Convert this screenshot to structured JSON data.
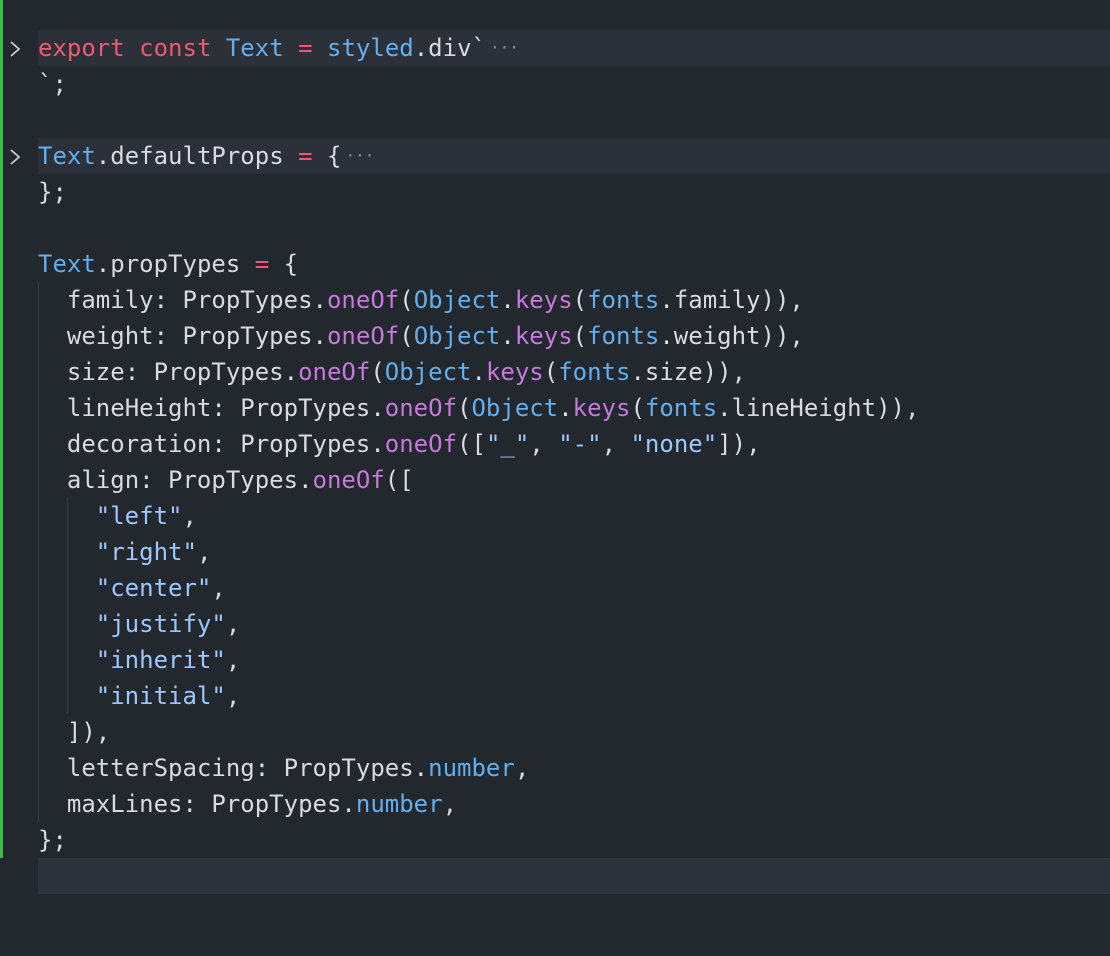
{
  "colors": {
    "background": "#23272e",
    "keyword": "#ef596f",
    "class": "#61afef",
    "function": "#c678dd",
    "string": "#9cc8ff",
    "text": "#d7dae0",
    "git_added": "#3fb950"
  },
  "lines": [
    {
      "folded": true,
      "tokens": [
        [
          "kw",
          "export"
        ],
        [
          "plain",
          " "
        ],
        [
          "kw",
          "const"
        ],
        [
          "plain",
          " "
        ],
        [
          "cls",
          "Text"
        ],
        [
          "plain",
          " "
        ],
        [
          "op",
          "="
        ],
        [
          "plain",
          " "
        ],
        [
          "cls",
          "styled"
        ],
        [
          "plain",
          ".div`"
        ]
      ]
    },
    {
      "folded": false,
      "tokens": [
        [
          "plain",
          "`;"
        ]
      ]
    },
    {
      "folded": false,
      "tokens": []
    },
    {
      "folded": true,
      "tokens": [
        [
          "cls",
          "Text"
        ],
        [
          "plain",
          ".defaultProps "
        ],
        [
          "op",
          "="
        ],
        [
          "plain",
          " {"
        ]
      ]
    },
    {
      "folded": false,
      "tokens": [
        [
          "plain",
          "};"
        ]
      ]
    },
    {
      "folded": false,
      "tokens": []
    },
    {
      "folded": false,
      "tokens": [
        [
          "cls",
          "Text"
        ],
        [
          "plain",
          ".propTypes "
        ],
        [
          "op",
          "="
        ],
        [
          "plain",
          " {"
        ]
      ]
    },
    {
      "folded": false,
      "indent": 1,
      "tokens": [
        [
          "plain",
          "family: PropTypes."
        ],
        [
          "fn",
          "oneOf"
        ],
        [
          "plain",
          "("
        ],
        [
          "cls",
          "Object"
        ],
        [
          "plain",
          "."
        ],
        [
          "fn",
          "keys"
        ],
        [
          "plain",
          "("
        ],
        [
          "cls",
          "fonts"
        ],
        [
          "plain",
          ".family)),"
        ]
      ]
    },
    {
      "folded": false,
      "indent": 1,
      "tokens": [
        [
          "plain",
          "weight: PropTypes."
        ],
        [
          "fn",
          "oneOf"
        ],
        [
          "plain",
          "("
        ],
        [
          "cls",
          "Object"
        ],
        [
          "plain",
          "."
        ],
        [
          "fn",
          "keys"
        ],
        [
          "plain",
          "("
        ],
        [
          "cls",
          "fonts"
        ],
        [
          "plain",
          ".weight)),"
        ]
      ]
    },
    {
      "folded": false,
      "indent": 1,
      "tokens": [
        [
          "plain",
          "size: PropTypes."
        ],
        [
          "fn",
          "oneOf"
        ],
        [
          "plain",
          "("
        ],
        [
          "cls",
          "Object"
        ],
        [
          "plain",
          "."
        ],
        [
          "fn",
          "keys"
        ],
        [
          "plain",
          "("
        ],
        [
          "cls",
          "fonts"
        ],
        [
          "plain",
          ".size)),"
        ]
      ]
    },
    {
      "folded": false,
      "indent": 1,
      "tokens": [
        [
          "plain",
          "lineHeight: PropTypes."
        ],
        [
          "fn",
          "oneOf"
        ],
        [
          "plain",
          "("
        ],
        [
          "cls",
          "Object"
        ],
        [
          "plain",
          "."
        ],
        [
          "fn",
          "keys"
        ],
        [
          "plain",
          "("
        ],
        [
          "cls",
          "fonts"
        ],
        [
          "plain",
          ".lineHeight)),"
        ]
      ]
    },
    {
      "folded": false,
      "indent": 1,
      "tokens": [
        [
          "plain",
          "decoration: PropTypes."
        ],
        [
          "fn",
          "oneOf"
        ],
        [
          "plain",
          "(["
        ],
        [
          "str",
          "\"_\""
        ],
        [
          "plain",
          ", "
        ],
        [
          "str",
          "\"-\""
        ],
        [
          "plain",
          ", "
        ],
        [
          "str",
          "\"none\""
        ],
        [
          "plain",
          "]),"
        ]
      ]
    },
    {
      "folded": false,
      "indent": 1,
      "tokens": [
        [
          "plain",
          "align: PropTypes."
        ],
        [
          "fn",
          "oneOf"
        ],
        [
          "plain",
          "(["
        ]
      ]
    },
    {
      "folded": false,
      "indent": 2,
      "tokens": [
        [
          "str",
          "\"left\""
        ],
        [
          "plain",
          ","
        ]
      ]
    },
    {
      "folded": false,
      "indent": 2,
      "tokens": [
        [
          "str",
          "\"right\""
        ],
        [
          "plain",
          ","
        ]
      ]
    },
    {
      "folded": false,
      "indent": 2,
      "tokens": [
        [
          "str",
          "\"center\""
        ],
        [
          "plain",
          ","
        ]
      ]
    },
    {
      "folded": false,
      "indent": 2,
      "tokens": [
        [
          "str",
          "\"justify\""
        ],
        [
          "plain",
          ","
        ]
      ]
    },
    {
      "folded": false,
      "indent": 2,
      "tokens": [
        [
          "str",
          "\"inherit\""
        ],
        [
          "plain",
          ","
        ]
      ]
    },
    {
      "folded": false,
      "indent": 2,
      "tokens": [
        [
          "str",
          "\"initial\""
        ],
        [
          "plain",
          ","
        ]
      ]
    },
    {
      "folded": false,
      "indent": 1,
      "tokens": [
        [
          "plain",
          "]),"
        ]
      ]
    },
    {
      "folded": false,
      "indent": 1,
      "tokens": [
        [
          "plain",
          "letterSpacing: PropTypes."
        ],
        [
          "cls",
          "number"
        ],
        [
          "plain",
          ","
        ]
      ]
    },
    {
      "folded": false,
      "indent": 1,
      "tokens": [
        [
          "plain",
          "maxLines: PropTypes."
        ],
        [
          "cls",
          "number"
        ],
        [
          "plain",
          ","
        ]
      ]
    },
    {
      "folded": false,
      "tokens": [
        [
          "plain",
          "};"
        ]
      ]
    },
    {
      "folded": false,
      "cursor": true,
      "tokens": []
    }
  ],
  "fold_marker": "···",
  "fold_icon": "chevron-right-icon"
}
